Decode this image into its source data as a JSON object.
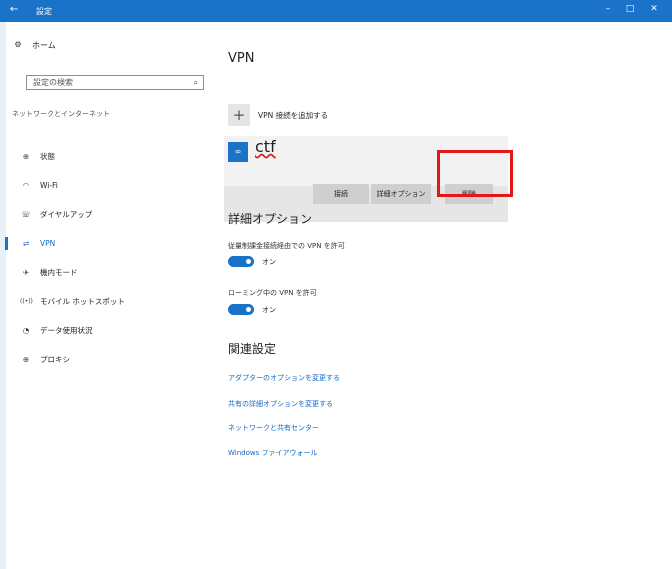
{
  "window": {
    "title": "設定",
    "back": "←",
    "minimize": "–",
    "maximize": "□",
    "close": "✕"
  },
  "sidebar": {
    "home": "ホーム",
    "search_placeholder": "設定の検索",
    "section": "ネットワークとインターネット",
    "items": [
      {
        "label": "状態",
        "icon": "status-icon",
        "glyph": "⊕"
      },
      {
        "label": "Wi-Fi",
        "icon": "wifi-icon",
        "glyph": "◠"
      },
      {
        "label": "ダイヤルアップ",
        "icon": "dialup-icon",
        "glyph": "☏"
      },
      {
        "label": "VPN",
        "icon": "vpn-icon",
        "glyph": "⇌"
      },
      {
        "label": "機内モード",
        "icon": "airplane-icon",
        "glyph": "✈"
      },
      {
        "label": "モバイル ホットスポット",
        "icon": "hotspot-icon",
        "glyph": "((•))"
      },
      {
        "label": "データ使用状況",
        "icon": "data-usage-icon",
        "glyph": "◔"
      },
      {
        "label": "プロキシ",
        "icon": "proxy-icon",
        "glyph": "⊕"
      }
    ],
    "active_index": 3
  },
  "main": {
    "title": "VPN",
    "add_vpn": "VPN 接続を追加する",
    "add_icon": "+",
    "connection": {
      "name": "ctf",
      "logo_text": "∞"
    },
    "buttons": {
      "connect": "接続",
      "advanced": "詳細オプション",
      "delete": "削除"
    },
    "advanced_heading": "詳細オプション",
    "metered_label": "従量制課金接続経由での VPN を許可",
    "metered_state": "オン",
    "roaming_label": "ローミング中の VPN を許可",
    "roaming_state": "オン",
    "related_heading": "関連設定",
    "links": [
      "アダプターのオプションを変更する",
      "共有の詳細オプションを変更する",
      "ネットワークと共有センター",
      "Windows ファイアウォール"
    ]
  },
  "colors": {
    "accent": "#1a73c9",
    "highlight": "#e01818"
  }
}
